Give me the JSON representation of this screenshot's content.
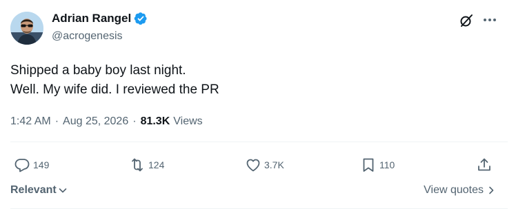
{
  "author": {
    "display_name": "Adrian Rangel",
    "handle": "@acrogenesis",
    "verified": true,
    "avatar_icon": "avatar-photo"
  },
  "post": {
    "lines": [
      "Shipped a baby boy last night.",
      "Well. My wife did. I reviewed the PR"
    ]
  },
  "meta": {
    "time": "1:42 AM",
    "separator": "·",
    "date": "Aug 25, 2026",
    "views_count": "81.3K",
    "views_label": "Views"
  },
  "actions": {
    "reply": {
      "icon": "reply-icon",
      "count": "149"
    },
    "retweet": {
      "icon": "retweet-icon",
      "count": "124"
    },
    "like": {
      "icon": "heart-icon",
      "count": "3.7K"
    },
    "bookmark": {
      "icon": "bookmark-icon",
      "count": "110"
    },
    "share": {
      "icon": "share-icon"
    }
  },
  "footer": {
    "sort_label": "Relevant",
    "view_quotes_label": "View quotes"
  },
  "colors": {
    "text_primary": "#0f1419",
    "text_secondary": "#536471",
    "verified_blue": "#1d9bf0",
    "divider": "#eff3f4"
  }
}
